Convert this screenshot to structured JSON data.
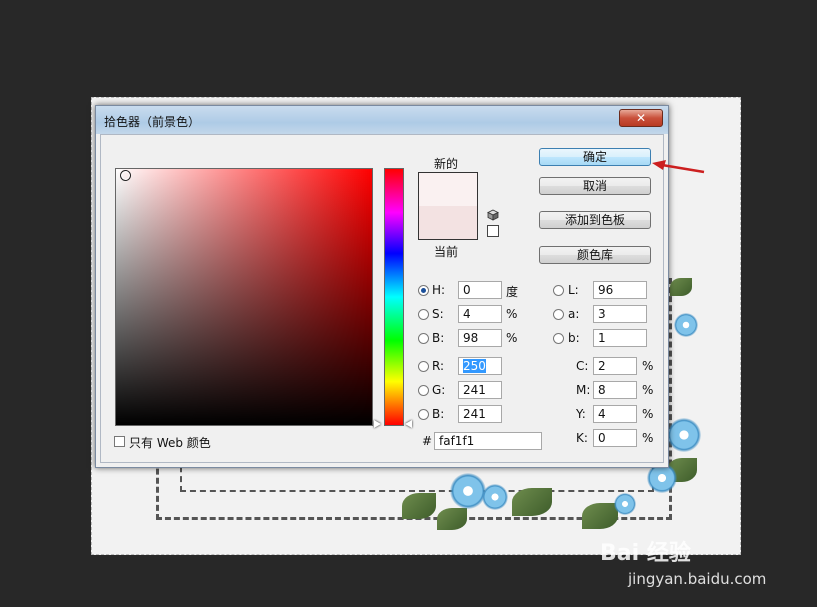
{
  "dialog": {
    "title": "拾色器（前景色）",
    "close_label": "✕"
  },
  "swatch": {
    "new_label": "新的",
    "current_label": "当前",
    "new_color": "#faf1f1",
    "current_color": "#f3e2e2"
  },
  "buttons": {
    "ok": "确定",
    "cancel": "取消",
    "add_to_swatches": "添加到色板",
    "color_libraries": "颜色库"
  },
  "hsb": [
    {
      "label": "H:",
      "value": "0",
      "unit": "度",
      "selected": true
    },
    {
      "label": "S:",
      "value": "4",
      "unit": "%",
      "selected": false
    },
    {
      "label": "B:",
      "value": "98",
      "unit": "%",
      "selected": false
    }
  ],
  "rgb": [
    {
      "label": "R:",
      "value": "250",
      "selected": false
    },
    {
      "label": "G:",
      "value": "241",
      "selected": false
    },
    {
      "label": "B:",
      "value": "241",
      "selected": false
    }
  ],
  "lab": [
    {
      "label": "L:",
      "value": "96"
    },
    {
      "label": "a:",
      "value": "3"
    },
    {
      "label": "b:",
      "value": "1"
    }
  ],
  "cmyk": [
    {
      "label": "C:",
      "value": "2",
      "unit": "%"
    },
    {
      "label": "M:",
      "value": "8",
      "unit": "%"
    },
    {
      "label": "Y:",
      "value": "4",
      "unit": "%"
    },
    {
      "label": "K:",
      "value": "0",
      "unit": "%"
    }
  ],
  "hex": {
    "label": "#",
    "value": "faf1f1"
  },
  "web_only": {
    "label": "只有 Web 颜色",
    "checked": false
  },
  "watermark": {
    "line1": "Bai 经验",
    "line2": "jingyan.baidu.com"
  },
  "colors": {
    "accent_arrow": "#cc1f1f",
    "field_hue": "#ff0000"
  },
  "icons": [
    "close-icon",
    "cube-icon",
    "arrow-pointer-icon"
  ]
}
